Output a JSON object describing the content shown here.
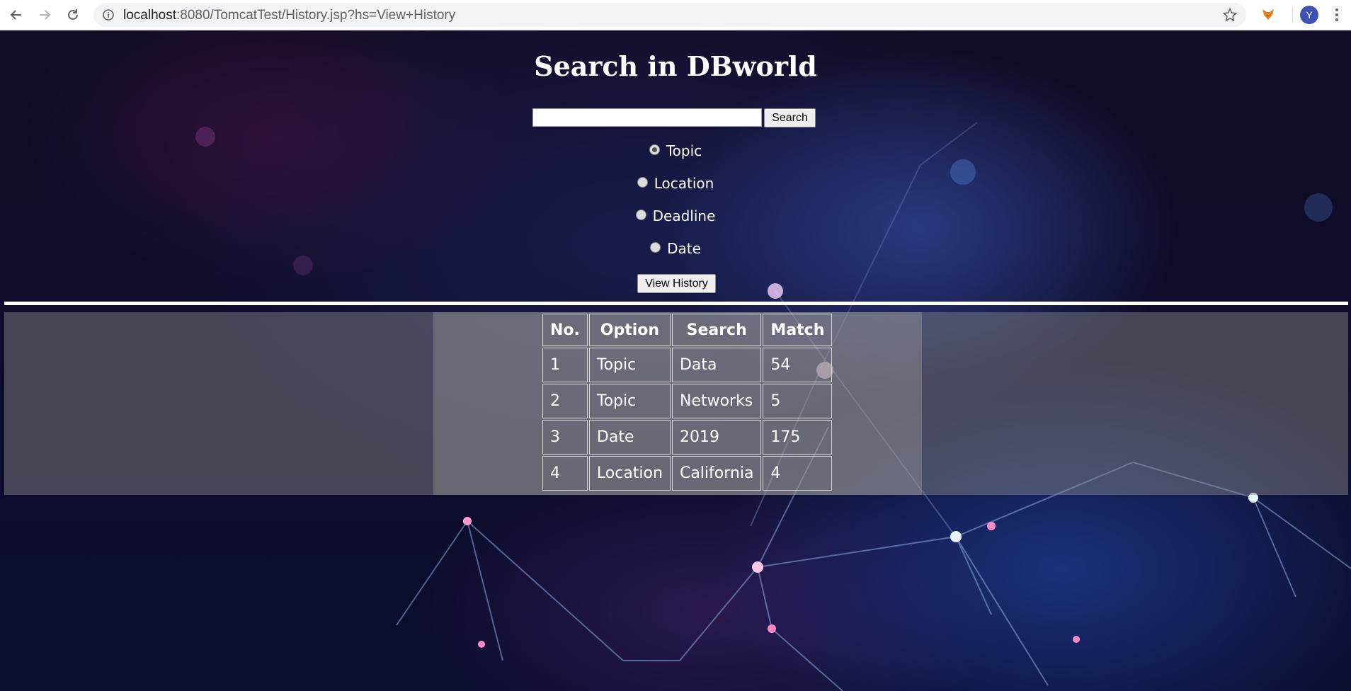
{
  "browser": {
    "url_host": "localhost",
    "url_rest": ":8080/TomcatTest/History.jsp?hs=View+History",
    "profile_initial": "Y"
  },
  "page": {
    "title": "Search in DBworld",
    "search": {
      "value": "",
      "button_label": "Search"
    },
    "options": [
      {
        "label": "Topic",
        "checked": true
      },
      {
        "label": "Location",
        "checked": false
      },
      {
        "label": "Deadline",
        "checked": false
      },
      {
        "label": "Date",
        "checked": false
      }
    ],
    "view_history_label": "View History"
  },
  "history_table": {
    "headers": [
      "No.",
      "Option",
      "Search",
      "Match"
    ],
    "rows": [
      [
        "1",
        "Topic",
        "Data",
        "54"
      ],
      [
        "2",
        "Topic",
        "Networks",
        "5"
      ],
      [
        "3",
        "Date",
        "2019",
        "175"
      ],
      [
        "4",
        "Location",
        "California",
        "4"
      ]
    ]
  },
  "colors": {
    "background": "#0b0a1e",
    "text": "#ffffff",
    "accent_profile": "#3f51b5"
  }
}
